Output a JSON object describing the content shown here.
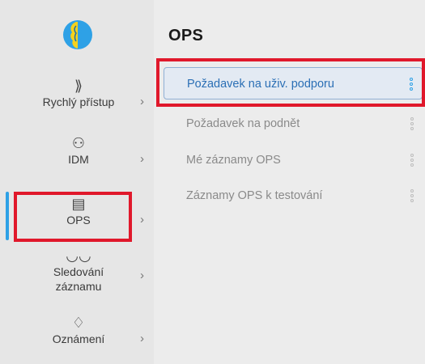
{
  "rail": {
    "items": [
      {
        "icon": "chevrons-right-icon",
        "glyph": "⟫",
        "label": "Rychlý přístup",
        "chevron": "›"
      },
      {
        "icon": "user-card-icon",
        "glyph": "⚇",
        "label": "IDM",
        "chevron": "›"
      },
      {
        "icon": "document-icon",
        "glyph": "▤",
        "label": "OPS",
        "chevron": "›",
        "active": true
      },
      {
        "icon": "glasses-icon",
        "glyph": "◡◡",
        "label_line1": "Sledování",
        "label_line2": "záznamu",
        "chevron": "›"
      },
      {
        "icon": "bell-icon",
        "glyph": "♢",
        "label": "Oznámení",
        "chevron": "›"
      }
    ]
  },
  "panel": {
    "title": "OPS",
    "items": [
      {
        "label": "Požadavek na uživ. podporu",
        "selected": true
      },
      {
        "label": "Požadavek na podnět"
      },
      {
        "label": "Mé záznamy OPS"
      },
      {
        "label": "Záznamy OPS k testování"
      }
    ]
  },
  "colors": {
    "accent": "#2ea1e6",
    "highlight": "#e0182b",
    "selected_text": "#2b6fb5"
  }
}
